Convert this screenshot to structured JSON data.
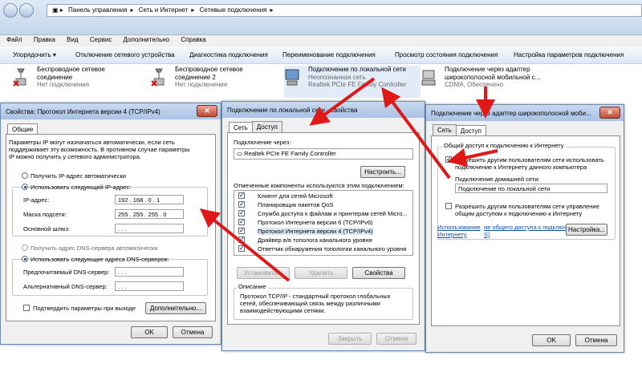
{
  "breadcrumb": [
    "Панель управления",
    "Сеть и Интернет",
    "Сетевые подключения"
  ],
  "menu": [
    "Файл",
    "Правка",
    "Вид",
    "Сервис",
    "Дополнительно",
    "Справка"
  ],
  "toolbar": [
    "Упорядочить ▾",
    "Отключение сетевого устройства",
    "Диагностика подключения",
    "Переименование подключения",
    "Просмотр состояния подключения",
    "Настройка параметров подключения"
  ],
  "connections": [
    {
      "name1": "Беспроводное сетевое",
      "name2": "соединение",
      "status": "Нет подключения"
    },
    {
      "name1": "Беспроводное сетевое",
      "name2": "соединение 2",
      "status": "Нет подключения"
    },
    {
      "name1": "Подключение по локальной сети",
      "name2": "Неопознанная сеть",
      "status": "Realtek PCIe FE Family Controller"
    },
    {
      "name1": "Подключение через адаптер",
      "name2": "широкополосной мобильной с...",
      "status": "CDMA, Обеспечено"
    }
  ],
  "ipv4": {
    "title": "Свойства: Протокол Интернета версии 4 (TCP/IPv4)",
    "tab": "Общие",
    "desc1": "Параметры IP могут назначаться автоматически, если сеть",
    "desc2": "поддерживает эту возможность. В противном случае параметры",
    "desc3": "IP можно получить у сетевого администратора.",
    "auto_ip": "Получить IP-адрес автоматически",
    "manual_ip": "Использовать следующий IP-адрес:",
    "ip_label": "IP-адрес:",
    "ip_value": "192 . 168 . 0 . 1",
    "mask_label": "Маска подсети:",
    "mask_value": "255 . 255 . 255 . 0",
    "gw_label": "Основной шлюз:",
    "gw_value": ".   .   .",
    "auto_dns": "Получить адрес DNS-сервера автоматически",
    "manual_dns": "Использовать следующие адреса DNS-серверов:",
    "pref_dns": "Предпочитаемый DNS-сервер:",
    "alt_dns": "Альтернативный DNS-сервер:",
    "dns_value": ".   .   .",
    "confirm": "Подтвердить параметры при выходе",
    "advanced": "Дополнительно...",
    "ok": "OK",
    "cancel": "Отмена"
  },
  "lan": {
    "title": "Подключение по локальной сети - свойства",
    "tab1": "Сеть",
    "tab2": "Доступ",
    "via": "Подключение через:",
    "adapter": "Realtek PCIe FE Family Controller",
    "configure": "Настроить...",
    "components_label": "Отмеченные компоненты используются этим подключением:",
    "components": [
      "Клиент для сетей Microsoft",
      "Планировщик пакетов QoS",
      "Служба доступа к файлам и принтерам сетей Micro...",
      "Протокол Интернета версии 6 (TCP/IPv6)",
      "Протокол Интернета версии 4 (TCP/IPv4)",
      "Драйвер в/в тополога канального уровня",
      "Ответчик обнаружения топологии канального уровня"
    ],
    "install": "Установить...",
    "remove": "Удалить",
    "properties": "Свойства",
    "desc_label": "Описание",
    "desc1": "Протокол TCP/IP - стандартный протокол глобальных",
    "desc2": "сетей, обеспечивающий связь между различными",
    "desc3": "взаимодействующими сетями.",
    "close": "Закрыть",
    "cancel": "Отмена"
  },
  "share": {
    "title": "Подключение через адаптер широкополосной моби...",
    "tab1": "Сеть",
    "tab2": "Доступ",
    "group": "Общий доступ к подключению к Интернету",
    "allow1": "Разрешить другим пользователям сети использовать",
    "allow2": "подключение к Интернету данного компьютера",
    "home_label": "Подключение домашней сети:",
    "home_value": "Подключение по локальной сети",
    "manage1": "Разрешить другим пользователям сети управление",
    "manage2": "общим доступом к подключению к Интернету",
    "link1": "Использование",
    "link2": "Интернету",
    "link3": "ие общего доступа к подключению к",
    "link4": "S)",
    "settings": "Настройка...",
    "ok": "OK",
    "cancel": "Отмена"
  }
}
